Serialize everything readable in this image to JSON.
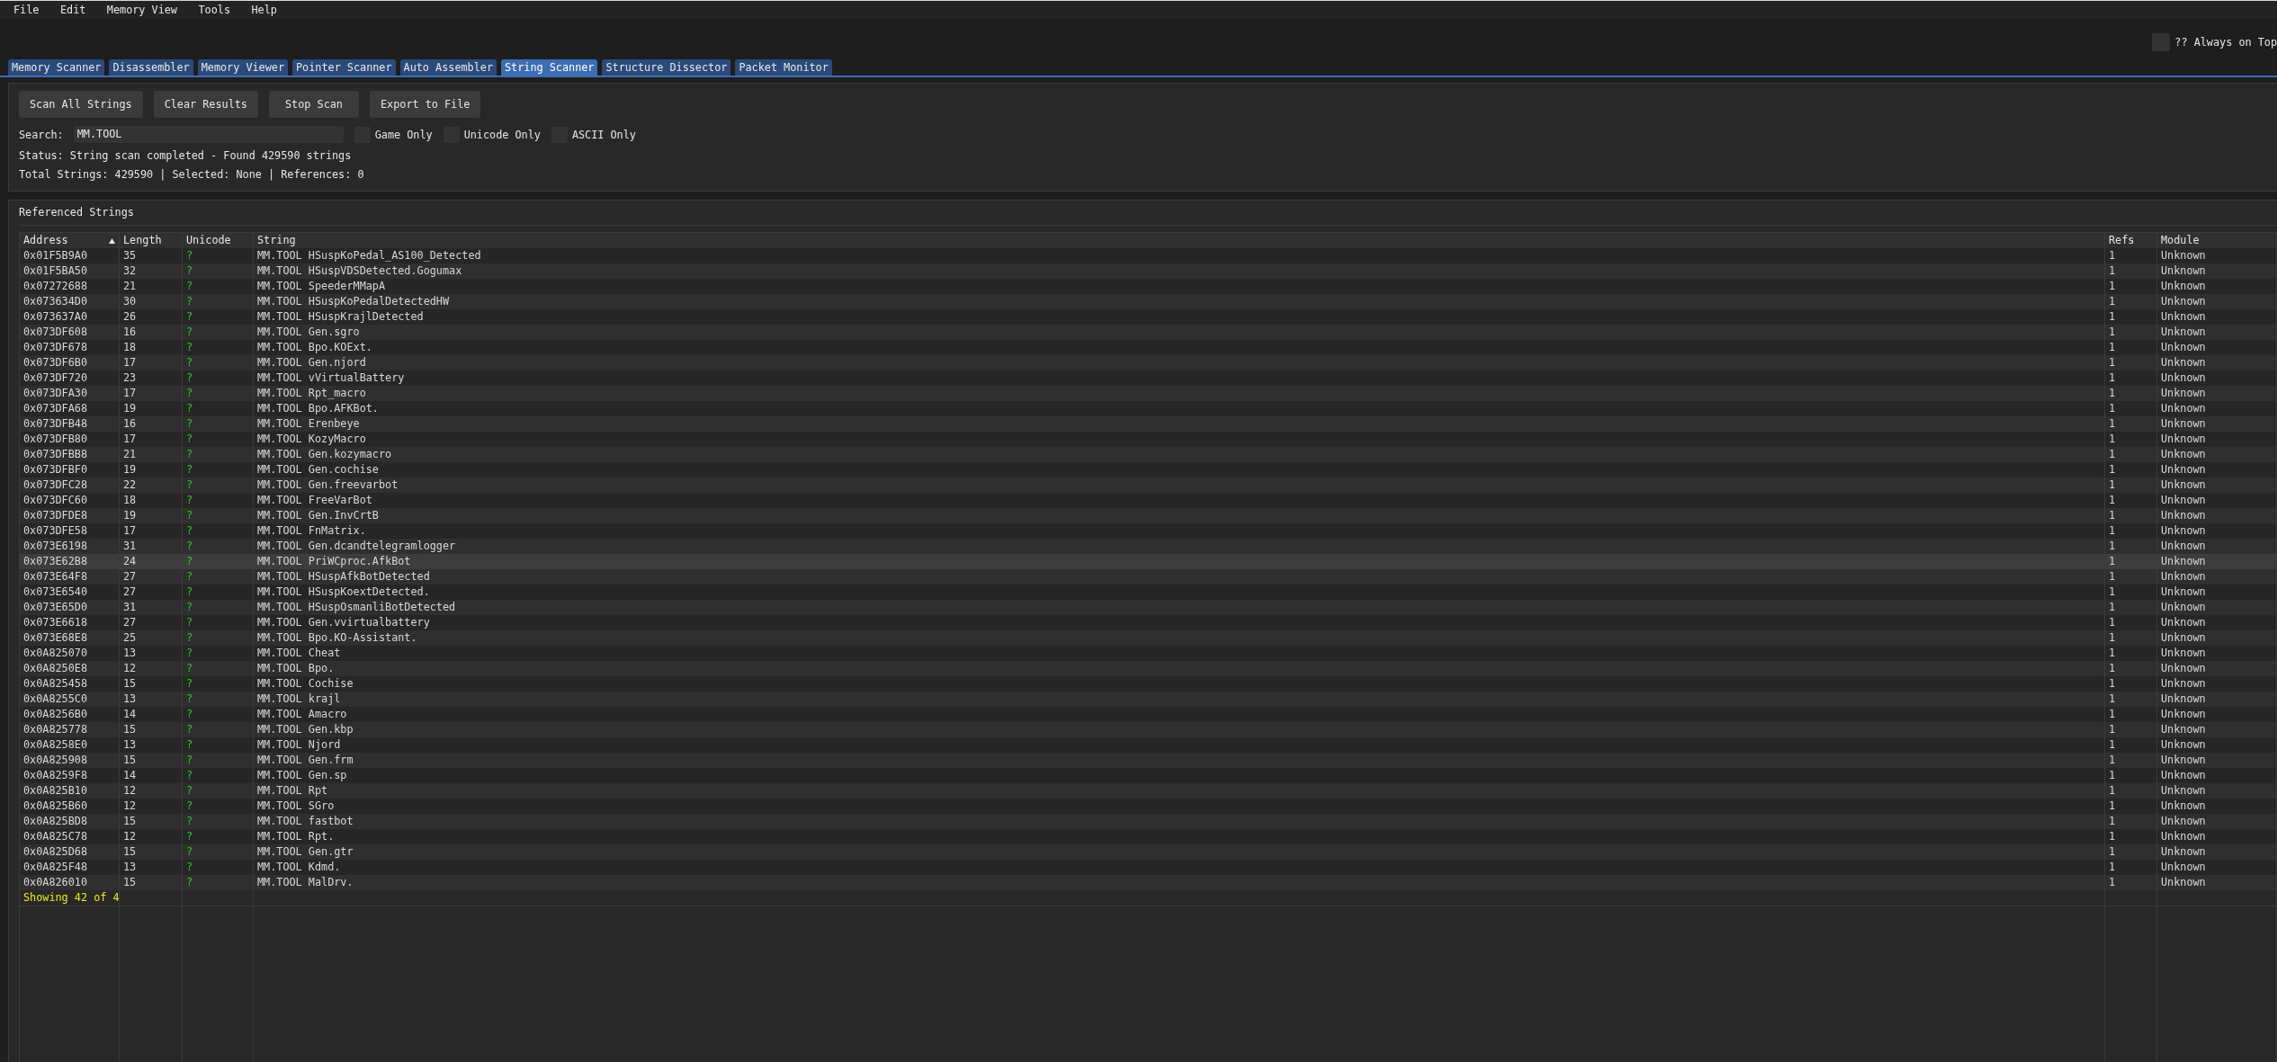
{
  "menu": [
    "File",
    "Edit",
    "Memory View",
    "Tools",
    "Help"
  ],
  "always_on_top": {
    "label": "?? Always on Top",
    "checked": false
  },
  "tabs": [
    {
      "label": "Memory Scanner",
      "selected": false
    },
    {
      "label": "Disassembler",
      "selected": false
    },
    {
      "label": "Memory Viewer",
      "selected": false
    },
    {
      "label": "Pointer Scanner",
      "selected": false
    },
    {
      "label": "Auto Assembler",
      "selected": false
    },
    {
      "label": "String Scanner",
      "selected": true
    },
    {
      "label": "Structure Dissector",
      "selected": false
    },
    {
      "label": "Packet Monitor",
      "selected": false
    }
  ],
  "buttons": [
    "Scan All Strings",
    "Clear Results",
    "Stop Scan",
    "Export to File"
  ],
  "search": {
    "label": "Search:",
    "value": "MM.TOOL"
  },
  "filters": [
    {
      "label": "Game Only",
      "checked": false
    },
    {
      "label": "Unicode Only",
      "checked": false
    },
    {
      "label": "ASCII Only",
      "checked": false
    }
  ],
  "status": "Status: String scan completed - Found 429590 strings",
  "summary": "Total Strings: 429590 | Selected: None | References: 0",
  "results": {
    "title": "Referenced Strings",
    "columns": [
      {
        "label": "Address",
        "sorted": true
      },
      {
        "label": "Length",
        "sorted": false
      },
      {
        "label": "Unicode",
        "sorted": false
      },
      {
        "label": "String",
        "sorted": false
      },
      {
        "label": "Refs",
        "sorted": false
      },
      {
        "label": "Module",
        "sorted": false
      }
    ],
    "rows": [
      {
        "address": "0x01F5B9A0",
        "length": "35",
        "unicode": "?",
        "string": "MM.TOOL HSuspKoPedal_AS100_Detected",
        "refs": "1",
        "module": "Unknown",
        "hovered": false
      },
      {
        "address": "0x01F5BA50",
        "length": "32",
        "unicode": "?",
        "string": "MM.TOOL HSuspVDSDetected.Gogumax",
        "refs": "1",
        "module": "Unknown",
        "hovered": false
      },
      {
        "address": "0x07272688",
        "length": "21",
        "unicode": "?",
        "string": "MM.TOOL SpeederMMapA",
        "refs": "1",
        "module": "Unknown",
        "hovered": false
      },
      {
        "address": "0x073634D0",
        "length": "30",
        "unicode": "?",
        "string": "MM.TOOL HSuspKoPedalDetectedHW",
        "refs": "1",
        "module": "Unknown",
        "hovered": false
      },
      {
        "address": "0x073637A0",
        "length": "26",
        "unicode": "?",
        "string": "MM.TOOL HSuspKrajlDetected",
        "refs": "1",
        "module": "Unknown",
        "hovered": false
      },
      {
        "address": "0x073DF608",
        "length": "16",
        "unicode": "?",
        "string": "MM.TOOL Gen.sgro",
        "refs": "1",
        "module": "Unknown",
        "hovered": false
      },
      {
        "address": "0x073DF678",
        "length": "18",
        "unicode": "?",
        "string": "MM.TOOL Bpo.KOExt.",
        "refs": "1",
        "module": "Unknown",
        "hovered": false
      },
      {
        "address": "0x073DF6B0",
        "length": "17",
        "unicode": "?",
        "string": "MM.TOOL Gen.njord",
        "refs": "1",
        "module": "Unknown",
        "hovered": false
      },
      {
        "address": "0x073DF720",
        "length": "23",
        "unicode": "?",
        "string": "MM.TOOL vVirtualBattery",
        "refs": "1",
        "module": "Unknown",
        "hovered": false
      },
      {
        "address": "0x073DFA30",
        "length": "17",
        "unicode": "?",
        "string": "MM.TOOL Rpt_macro",
        "refs": "1",
        "module": "Unknown",
        "hovered": false
      },
      {
        "address": "0x073DFA68",
        "length": "19",
        "unicode": "?",
        "string": "MM.TOOL Bpo.AFKBot.",
        "refs": "1",
        "module": "Unknown",
        "hovered": false
      },
      {
        "address": "0x073DFB48",
        "length": "16",
        "unicode": "?",
        "string": "MM.TOOL Erenbeye",
        "refs": "1",
        "module": "Unknown",
        "hovered": false
      },
      {
        "address": "0x073DFB80",
        "length": "17",
        "unicode": "?",
        "string": "MM.TOOL KozyMacro",
        "refs": "1",
        "module": "Unknown",
        "hovered": false
      },
      {
        "address": "0x073DFBB8",
        "length": "21",
        "unicode": "?",
        "string": "MM.TOOL Gen.kozymacro",
        "refs": "1",
        "module": "Unknown",
        "hovered": false
      },
      {
        "address": "0x073DFBF0",
        "length": "19",
        "unicode": "?",
        "string": "MM.TOOL Gen.cochise",
        "refs": "1",
        "module": "Unknown",
        "hovered": false
      },
      {
        "address": "0x073DFC28",
        "length": "22",
        "unicode": "?",
        "string": "MM.TOOL Gen.freevarbot",
        "refs": "1",
        "module": "Unknown",
        "hovered": false
      },
      {
        "address": "0x073DFC60",
        "length": "18",
        "unicode": "?",
        "string": "MM.TOOL FreeVarBot",
        "refs": "1",
        "module": "Unknown",
        "hovered": false
      },
      {
        "address": "0x073DFDE8",
        "length": "19",
        "unicode": "?",
        "string": "MM.TOOL Gen.InvCrtB",
        "refs": "1",
        "module": "Unknown",
        "hovered": false
      },
      {
        "address": "0x073DFE58",
        "length": "17",
        "unicode": "?",
        "string": "MM.TOOL FnMatrix.",
        "refs": "1",
        "module": "Unknown",
        "hovered": false
      },
      {
        "address": "0x073E6198",
        "length": "31",
        "unicode": "?",
        "string": "MM.TOOL Gen.dcandtelegramlogger",
        "refs": "1",
        "module": "Unknown",
        "hovered": false
      },
      {
        "address": "0x073E62B8",
        "length": "24",
        "unicode": "?",
        "string": "MM.TOOL PriWCproc.AfkBot",
        "refs": "1",
        "module": "Unknown",
        "hovered": true
      },
      {
        "address": "0x073E64F8",
        "length": "27",
        "unicode": "?",
        "string": "MM.TOOL HSuspAfkBotDetected",
        "refs": "1",
        "module": "Unknown",
        "hovered": false
      },
      {
        "address": "0x073E6540",
        "length": "27",
        "unicode": "?",
        "string": "MM.TOOL HSuspKoextDetected.",
        "refs": "1",
        "module": "Unknown",
        "hovered": false
      },
      {
        "address": "0x073E65D0",
        "length": "31",
        "unicode": "?",
        "string": "MM.TOOL HSuspOsmanliBotDetected",
        "refs": "1",
        "module": "Unknown",
        "hovered": false
      },
      {
        "address": "0x073E6618",
        "length": "27",
        "unicode": "?",
        "string": "MM.TOOL Gen.vvirtualbattery",
        "refs": "1",
        "module": "Unknown",
        "hovered": false
      },
      {
        "address": "0x073E68E8",
        "length": "25",
        "unicode": "?",
        "string": "MM.TOOL Bpo.KO-Assistant.",
        "refs": "1",
        "module": "Unknown",
        "hovered": false
      },
      {
        "address": "0x0A825070",
        "length": "13",
        "unicode": "?",
        "string": "MM.TOOL Cheat",
        "refs": "1",
        "module": "Unknown",
        "hovered": false
      },
      {
        "address": "0x0A8250E8",
        "length": "12",
        "unicode": "?",
        "string": "MM.TOOL Bpo.",
        "refs": "1",
        "module": "Unknown",
        "hovered": false
      },
      {
        "address": "0x0A825458",
        "length": "15",
        "unicode": "?",
        "string": "MM.TOOL Cochise",
        "refs": "1",
        "module": "Unknown",
        "hovered": false
      },
      {
        "address": "0x0A8255C0",
        "length": "13",
        "unicode": "?",
        "string": "MM.TOOL krajl",
        "refs": "1",
        "module": "Unknown",
        "hovered": false
      },
      {
        "address": "0x0A8256B0",
        "length": "14",
        "unicode": "?",
        "string": "MM.TOOL Amacro",
        "refs": "1",
        "module": "Unknown",
        "hovered": false
      },
      {
        "address": "0x0A825778",
        "length": "15",
        "unicode": "?",
        "string": "MM.TOOL Gen.kbp",
        "refs": "1",
        "module": "Unknown",
        "hovered": false
      },
      {
        "address": "0x0A8258E0",
        "length": "13",
        "unicode": "?",
        "string": "MM.TOOL Njord",
        "refs": "1",
        "module": "Unknown",
        "hovered": false
      },
      {
        "address": "0x0A825908",
        "length": "15",
        "unicode": "?",
        "string": "MM.TOOL Gen.frm",
        "refs": "1",
        "module": "Unknown",
        "hovered": false
      },
      {
        "address": "0x0A8259F8",
        "length": "14",
        "unicode": "?",
        "string": "MM.TOOL Gen.sp",
        "refs": "1",
        "module": "Unknown",
        "hovered": false
      },
      {
        "address": "0x0A825B10",
        "length": "12",
        "unicode": "?",
        "string": "MM.TOOL Rpt",
        "refs": "1",
        "module": "Unknown",
        "hovered": false
      },
      {
        "address": "0x0A825B60",
        "length": "12",
        "unicode": "?",
        "string": "MM.TOOL SGro",
        "refs": "1",
        "module": "Unknown",
        "hovered": false
      },
      {
        "address": "0x0A825BD8",
        "length": "15",
        "unicode": "?",
        "string": "MM.TOOL fastbot",
        "refs": "1",
        "module": "Unknown",
        "hovered": false
      },
      {
        "address": "0x0A825C78",
        "length": "12",
        "unicode": "?",
        "string": "MM.TOOL Rpt.",
        "refs": "1",
        "module": "Unknown",
        "hovered": false
      },
      {
        "address": "0x0A825D68",
        "length": "15",
        "unicode": "?",
        "string": "MM.TOOL Gen.gtr",
        "refs": "1",
        "module": "Unknown",
        "hovered": false
      },
      {
        "address": "0x0A825F48",
        "length": "13",
        "unicode": "?",
        "string": "MM.TOOL Kdmd.",
        "refs": "1",
        "module": "Unknown",
        "hovered": false
      },
      {
        "address": "0x0A826010",
        "length": "15",
        "unicode": "?",
        "string": "MM.TOOL MalDrv.",
        "refs": "1",
        "module": "Unknown",
        "hovered": false
      }
    ],
    "footer": "Showing 42 of 4"
  }
}
